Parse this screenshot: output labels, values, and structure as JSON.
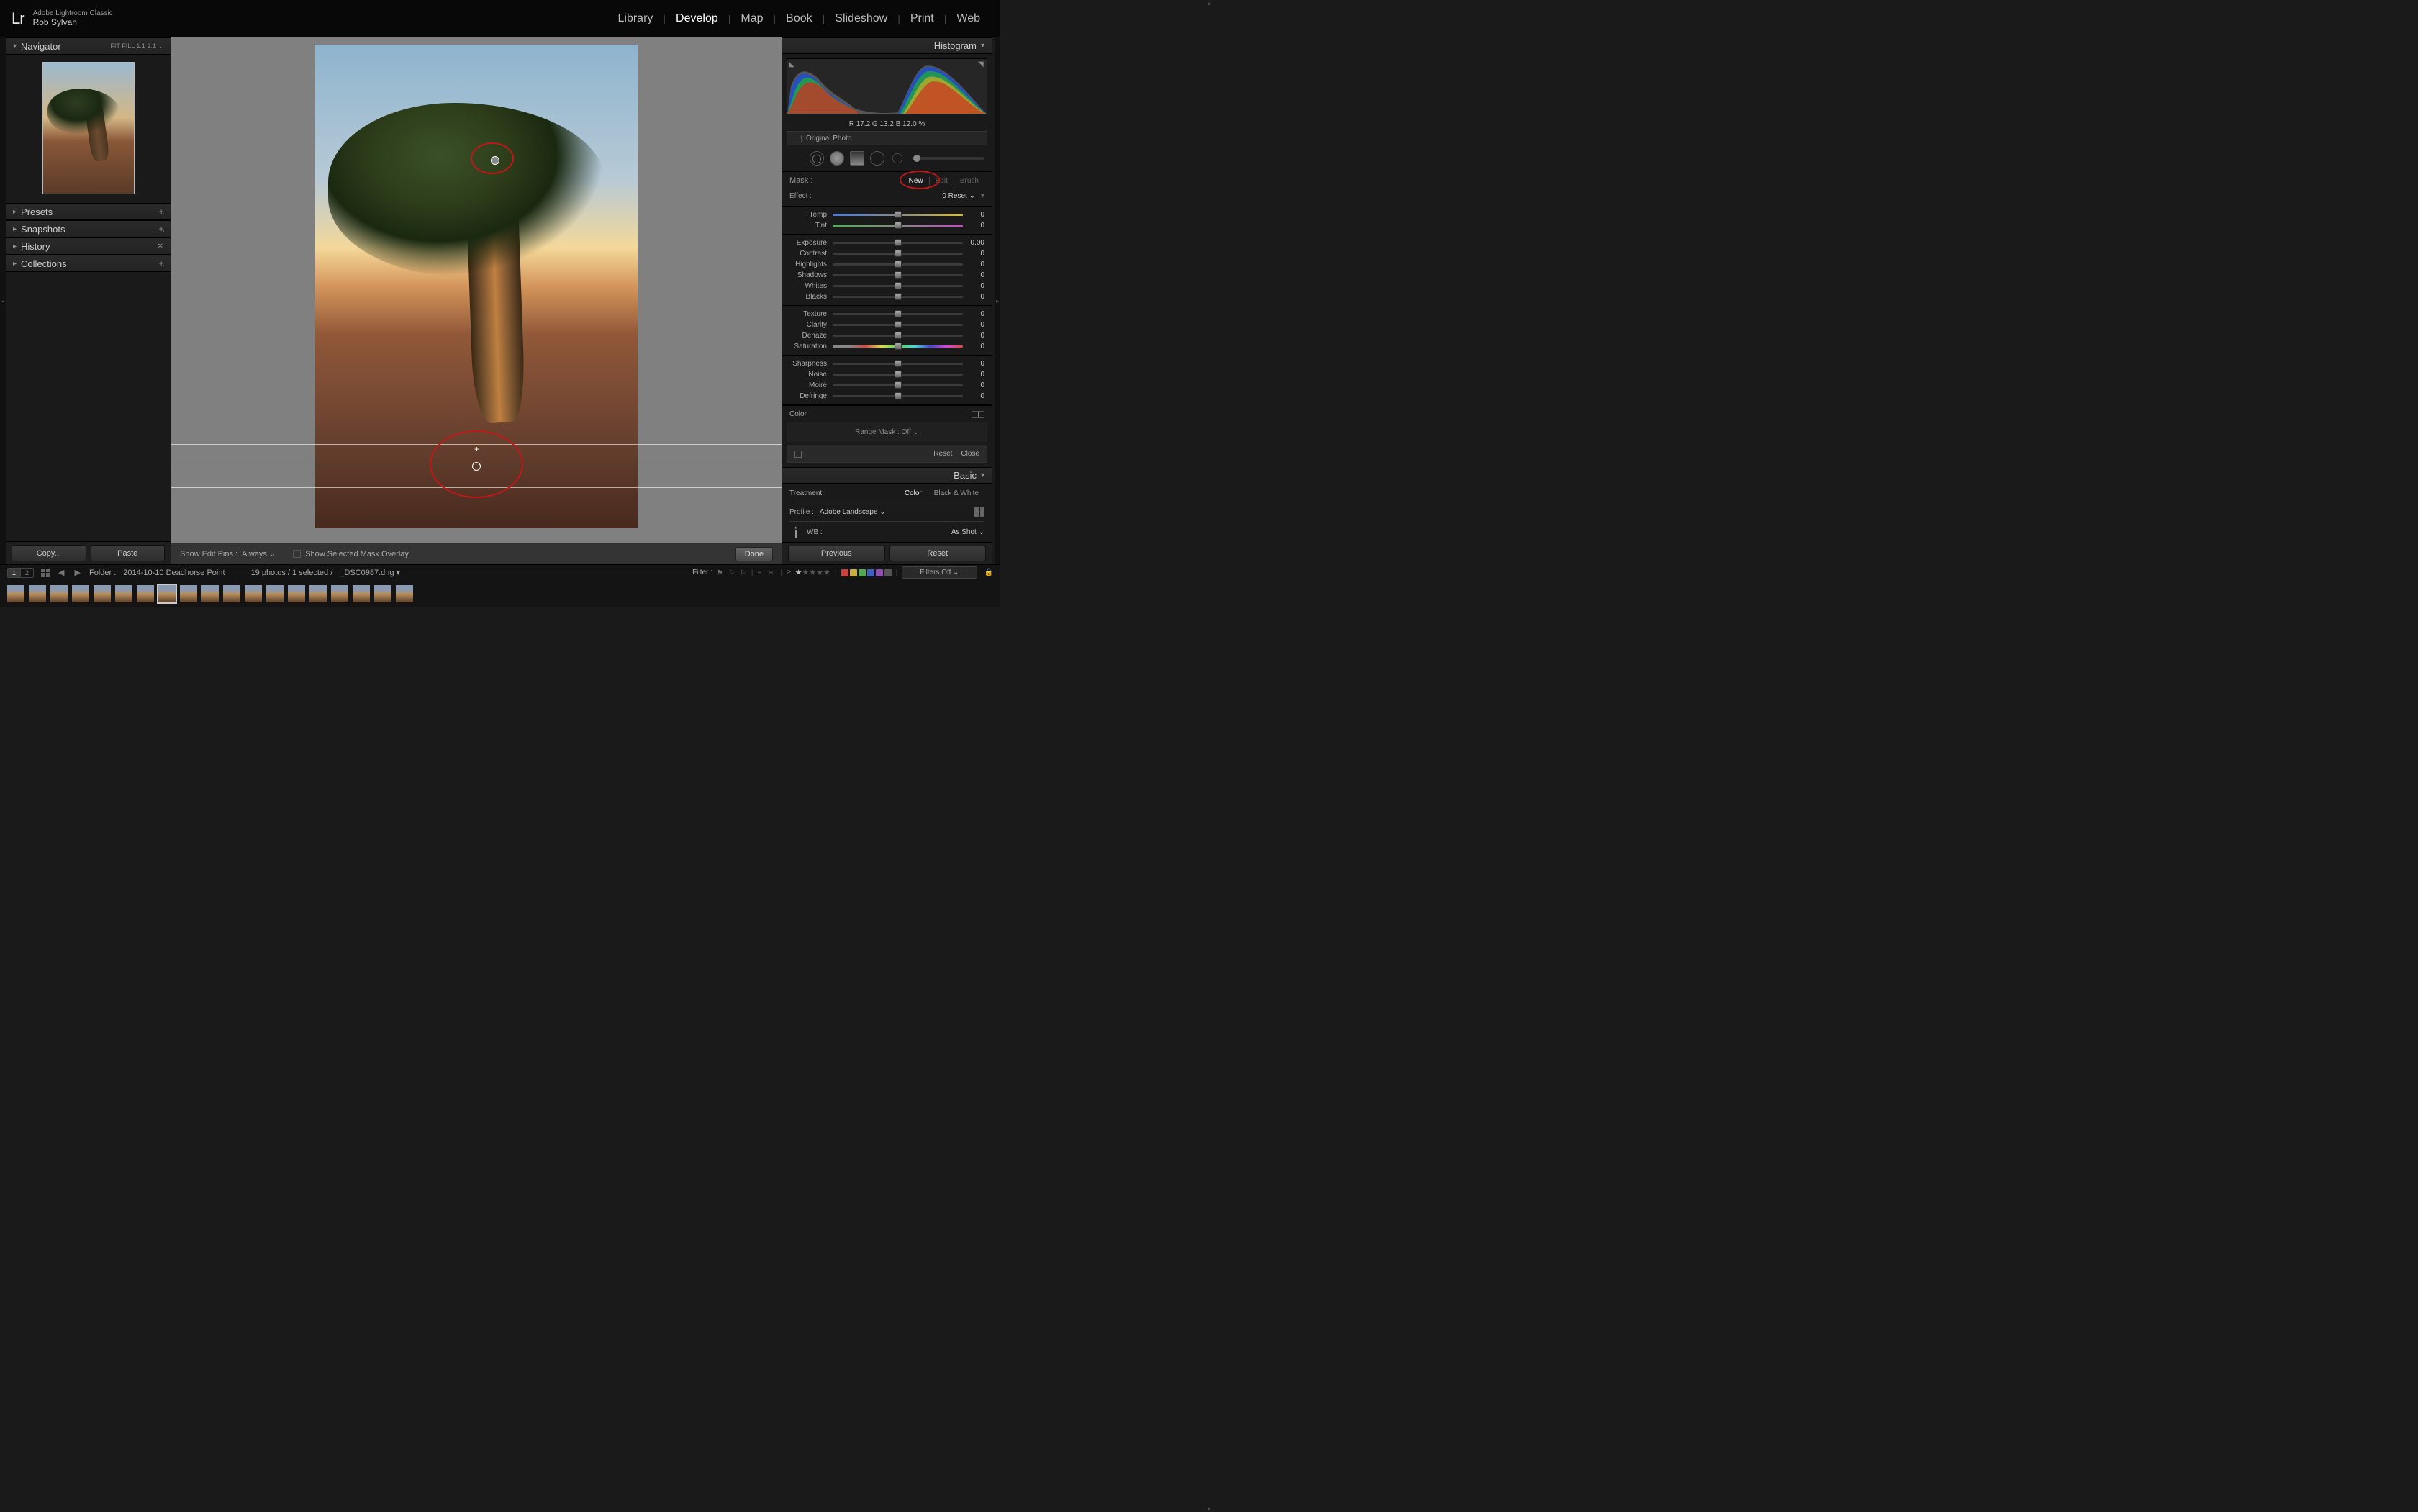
{
  "app": {
    "name": "Adobe Lightroom Classic",
    "user": "Rob Sylvan",
    "logo": "Lr"
  },
  "modules": [
    "Library",
    "Develop",
    "Map",
    "Book",
    "Slideshow",
    "Print",
    "Web"
  ],
  "active_module": "Develop",
  "navigator": {
    "title": "Navigator",
    "zoom_opts": "FIT   FILL   1:1   2:1  ⌄"
  },
  "left_panels": {
    "presets": "Presets",
    "snapshots": "Snapshots",
    "history": "History",
    "collections": "Collections"
  },
  "left_buttons": {
    "copy": "Copy...",
    "paste": "Paste"
  },
  "center_toolbar": {
    "pins_label": "Show Edit Pins :",
    "pins_value": "Always  ⌄",
    "overlay": "Show Selected Mask Overlay",
    "done": "Done"
  },
  "right_buttons": {
    "previous": "Previous",
    "reset": "Reset"
  },
  "histogram": {
    "title": "Histogram",
    "rgb": "R   17.2   G   13.2   B   12.0 %",
    "original": "Original Photo"
  },
  "mask": {
    "label": "Mask :",
    "tabs": [
      "New",
      "Edit",
      "Brush"
    ],
    "active_tab": "New",
    "effect_label": "Effect :",
    "effect_value": "0 Reset  ⌄"
  },
  "sliders": {
    "temp": {
      "label": "Temp",
      "value": "0"
    },
    "tint": {
      "label": "Tint",
      "value": "0"
    },
    "exposure": {
      "label": "Exposure",
      "value": "0.00"
    },
    "contrast": {
      "label": "Contrast",
      "value": "0"
    },
    "highlights": {
      "label": "Highlights",
      "value": "0"
    },
    "shadows": {
      "label": "Shadows",
      "value": "0"
    },
    "whites": {
      "label": "Whites",
      "value": "0"
    },
    "blacks": {
      "label": "Blacks",
      "value": "0"
    },
    "texture": {
      "label": "Texture",
      "value": "0"
    },
    "clarity": {
      "label": "Clarity",
      "value": "0"
    },
    "dehaze": {
      "label": "Dehaze",
      "value": "0"
    },
    "saturation": {
      "label": "Saturation",
      "value": "0"
    },
    "sharpness": {
      "label": "Sharpness",
      "value": "0"
    },
    "noise": {
      "label": "Noise",
      "value": "0"
    },
    "moire": {
      "label": "Moiré",
      "value": "0"
    },
    "defringe": {
      "label": "Defringe",
      "value": "0"
    }
  },
  "color_label": "Color",
  "range_mask": "Range Mask :  Off  ⌄",
  "reset_close": {
    "reset": "Reset",
    "close": "Close"
  },
  "basic": {
    "title": "Basic",
    "treatment": "Treatment :",
    "color": "Color",
    "bw": "Black & White",
    "profile": "Profile :",
    "profile_value": "Adobe Landscape  ⌄",
    "wb": "WB :",
    "wb_value": "As Shot  ⌄"
  },
  "filmstrip": {
    "view1": "1",
    "view2": "2",
    "folder_label": "Folder :",
    "folder": "2014-10-10 Deadhorse Point",
    "status": "19 photos / 1 selected /",
    "filename": "_DSC0987.dng  ▾",
    "filter_label": "Filter :",
    "filters_off": "Filters Off        ⌄",
    "thumb_count": 19,
    "selected_index": 7
  },
  "colors": {
    "red": "#c84040",
    "yellow": "#c8b040",
    "green": "#50a850",
    "blue": "#4060c0",
    "purple": "#9050b0",
    "none": "#555"
  }
}
